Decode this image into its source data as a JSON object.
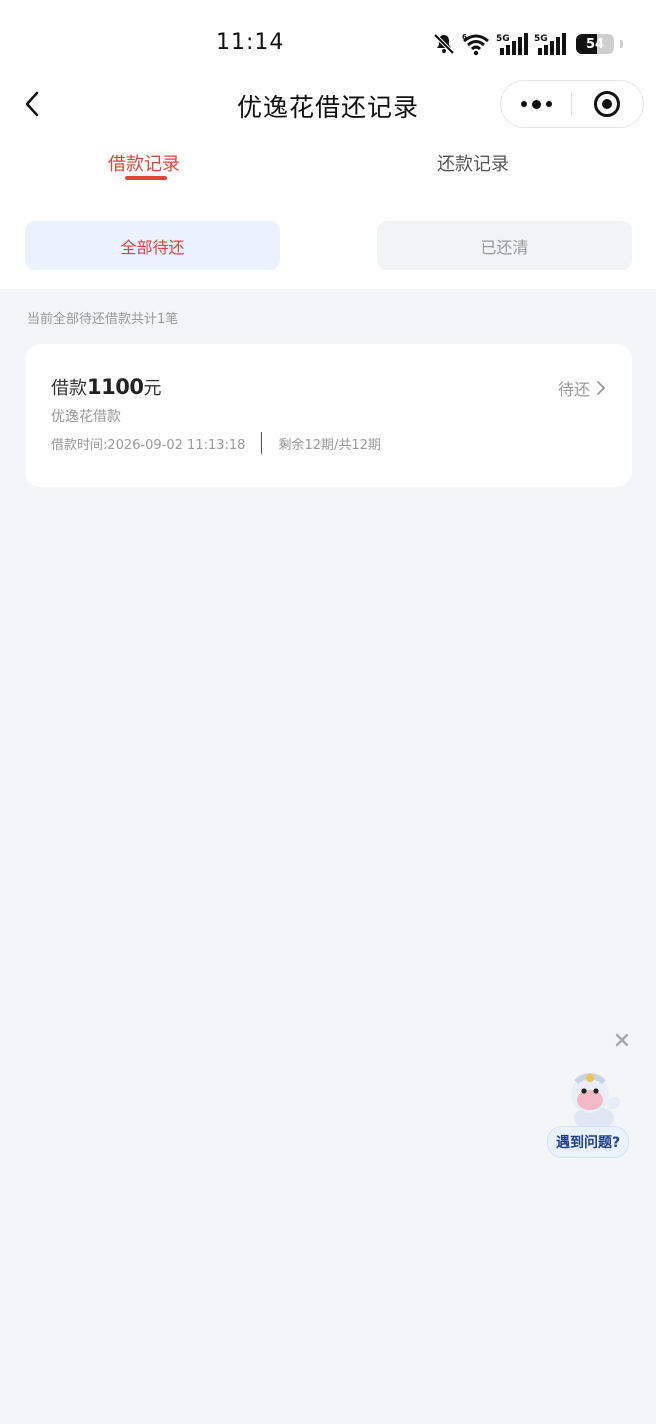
{
  "status_bar": {
    "time": "11:14",
    "battery": "54",
    "icons": [
      "mute-bell-icon",
      "wifi-icon",
      "signal-5g-icon",
      "signal-5g-icon",
      "battery-icon"
    ]
  },
  "header": {
    "title": "优逸花借还记录",
    "back_icon": "chevron-left-icon",
    "more_icon": "more-dots-icon",
    "target_icon": "target-icon"
  },
  "tabs": [
    {
      "label": "借款记录",
      "active": true
    },
    {
      "label": "还款记录",
      "active": false
    }
  ],
  "filters": [
    {
      "label": "全部待还",
      "active": true
    },
    {
      "label": "已还清",
      "active": false
    }
  ],
  "summary": "当前全部待还借款共计1笔",
  "loan": {
    "prefix": "借款",
    "amount": "1100",
    "unit": "元",
    "status": "待还",
    "product": "优逸花借款",
    "time": "借款时间:2026-09-02 11:13:18",
    "periods": "剩余12期/共12期"
  },
  "helper": {
    "label": "遇到问题?",
    "close_icon": "close-icon"
  },
  "colors": {
    "accent": "#e0443a",
    "background": "#f4f5f7",
    "active_filter_bg": "#ecf2fd"
  }
}
